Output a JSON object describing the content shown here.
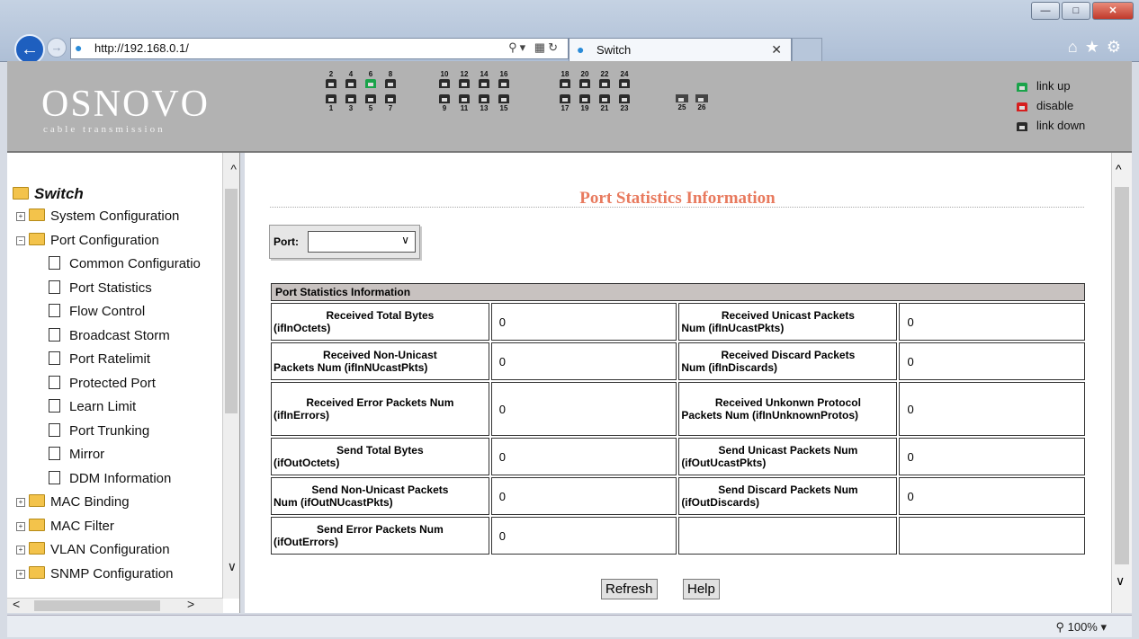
{
  "browser": {
    "url": "http://192.168.0.1/",
    "tab_title": "Switch",
    "zoom_level": "100%",
    "window_controls": [
      "minimize",
      "maximize",
      "close"
    ],
    "icons": [
      "back-icon",
      "forward-icon",
      "search-icon",
      "refresh-icon",
      "home-icon",
      "favorites-icon",
      "settings-icon"
    ]
  },
  "brand": {
    "name": "OSNOVO",
    "tagline": "cable transmission"
  },
  "ports": {
    "top_row": [
      "2",
      "4",
      "6",
      "8",
      "10",
      "12",
      "14",
      "16",
      "18",
      "20",
      "22",
      "24"
    ],
    "bottom_row": [
      "1",
      "3",
      "5",
      "7",
      "9",
      "11",
      "13",
      "15",
      "17",
      "19",
      "21",
      "23"
    ],
    "sfp": [
      "25",
      "26"
    ],
    "link_up_ports": [
      "6"
    ]
  },
  "legend": {
    "link_up": "link up",
    "disable": "disable",
    "link_down": "link down"
  },
  "nav": {
    "root": "Switch",
    "items": [
      {
        "label": "System Configuration",
        "type": "folder",
        "level": 1
      },
      {
        "label": "Port Configuration",
        "type": "folder-open",
        "level": 1
      },
      {
        "label": "Common Configuratio",
        "type": "doc",
        "level": 2
      },
      {
        "label": "Port Statistics",
        "type": "doc",
        "level": 2
      },
      {
        "label": "Flow Control",
        "type": "doc",
        "level": 2
      },
      {
        "label": "Broadcast Storm",
        "type": "doc",
        "level": 2
      },
      {
        "label": "Port Ratelimit",
        "type": "doc",
        "level": 2
      },
      {
        "label": "Protected Port",
        "type": "doc",
        "level": 2
      },
      {
        "label": "Learn Limit",
        "type": "doc",
        "level": 2
      },
      {
        "label": "Port Trunking",
        "type": "doc",
        "level": 2
      },
      {
        "label": "Mirror",
        "type": "doc",
        "level": 2
      },
      {
        "label": "DDM Information",
        "type": "doc",
        "level": 2
      },
      {
        "label": "MAC Binding",
        "type": "folder",
        "level": 1
      },
      {
        "label": "MAC Filter",
        "type": "folder",
        "level": 1
      },
      {
        "label": "VLAN Configuration",
        "type": "folder",
        "level": 1
      },
      {
        "label": "SNMP Configuration",
        "type": "folder",
        "level": 1
      }
    ]
  },
  "main": {
    "title": "Port Statistics Information",
    "port_label": "Port:",
    "port_value": "",
    "table_header": "Port Statistics Information",
    "rows": [
      {
        "l1a": "Received Total Bytes",
        "l1b": "(ifInOctets)",
        "v1": "0",
        "l2a": "Received Unicast Packets",
        "l2b": "Num (ifInUcastPkts)",
        "v2": "0"
      },
      {
        "l1a": "Received Non-Unicast",
        "l1b": "Packets Num (ifInNUcastPkts)",
        "v1": "0",
        "l2a": "Received Discard Packets",
        "l2b": "Num (ifInDiscards)",
        "v2": "0"
      },
      {
        "l1a": "Received Error Packets Num",
        "l1b": "(ifInErrors)",
        "v1": "0",
        "l2a": "Received Unkonwn Protocol",
        "l2b": "Packets Num (ifInUnknownProtos)",
        "v2": "0"
      },
      {
        "l1a": "Send Total Bytes",
        "l1b": "(ifOutOctets)",
        "v1": "0",
        "l2a": "Send Unicast Packets Num",
        "l2b": "(ifOutUcastPkts)",
        "v2": "0"
      },
      {
        "l1a": "Send Non-Unicast Packets",
        "l1b": "Num (ifOutNUcastPkts)",
        "v1": "0",
        "l2a": "Send Discard Packets Num",
        "l2b": "(ifOutDiscards)",
        "v2": "0"
      },
      {
        "l1a": "Send Error Packets Num",
        "l1b": "(ifOutErrors)",
        "v1": "0",
        "l2a": "",
        "l2b": "",
        "v2": ""
      }
    ],
    "refresh_label": "Refresh",
    "help_label": "Help"
  },
  "colors": {
    "title": "#e87a5e",
    "header_bg": "#b2b2b2",
    "link_up": "#1aa34a",
    "disable": "#d61e1e"
  }
}
